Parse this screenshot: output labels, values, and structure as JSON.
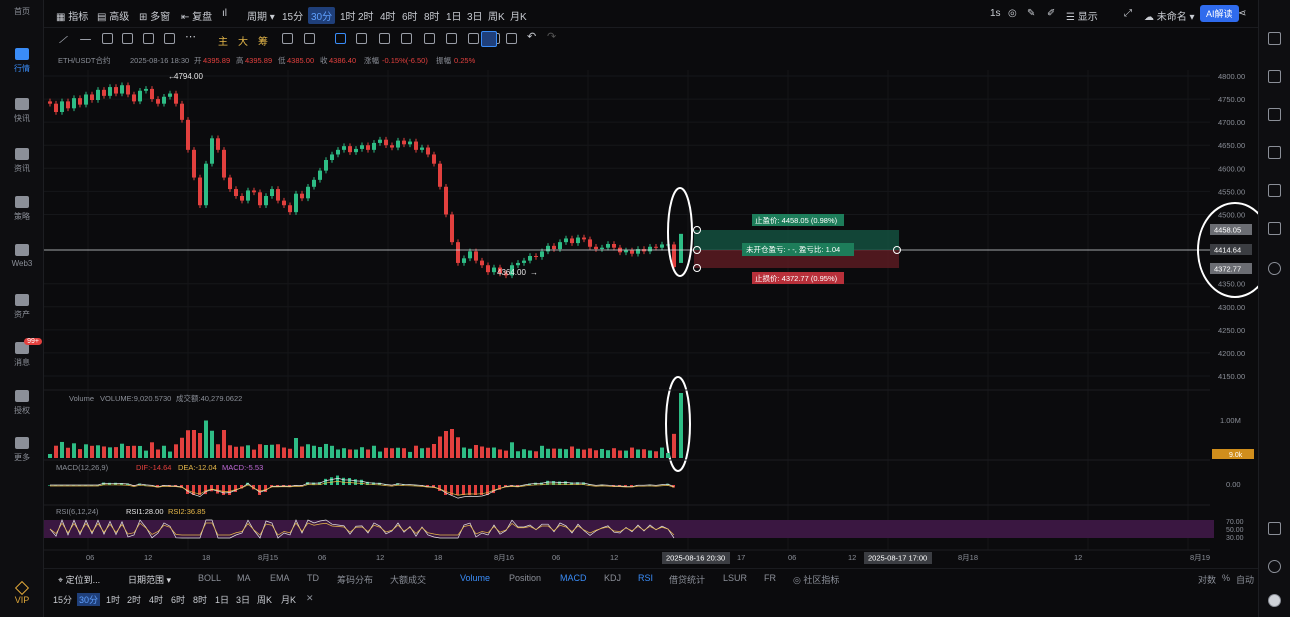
{
  "sidebar": {
    "items": [
      {
        "label": "首页"
      },
      {
        "label": "行情"
      },
      {
        "label": "快讯"
      },
      {
        "label": "资讯"
      },
      {
        "label": "策略"
      },
      {
        "label": "Web3"
      },
      {
        "label": "资产"
      },
      {
        "label": "消息"
      },
      {
        "label": "授权"
      },
      {
        "label": "更多"
      }
    ],
    "badge": "99+",
    "vip": "VIP"
  },
  "toolbar": {
    "indicators": "指标",
    "advanced": "高级",
    "multi_chart": "多窗",
    "replay": "复盘",
    "period": "周期",
    "intervals": [
      "15分",
      "30分",
      "1时",
      "2时",
      "4时",
      "6时",
      "8时",
      "1日",
      "3日",
      "周K",
      "月K"
    ],
    "interval_selected": "30分",
    "tick_interval": "1s",
    "display": "显示",
    "layout_name": "未命名",
    "ai": "AI解读"
  },
  "draw_tools": {
    "main": "主",
    "big": "大",
    "chips": "筹"
  },
  "info_line": {
    "symbol": "ETH/USDT合约",
    "time": "2025-08-16 18:30",
    "open_label": "开",
    "open": "4395.89",
    "high_label": "高",
    "high": "4395.89",
    "low_label": "低",
    "low": "4385.00",
    "close_label": "收",
    "close": "4386.40",
    "change_label": "涨幅",
    "change": "-0.15%(-6.50)",
    "amplitude_label": "振幅",
    "amplitude": "0.25%"
  },
  "chart_data": {
    "type": "candlestick",
    "symbol": "ETH/USDT",
    "interval": "30分",
    "ylim": [
      4150,
      4800
    ],
    "price_ticks": [
      "4800.00",
      "4750.00",
      "4700.00",
      "4650.00",
      "4600.00",
      "4550.00",
      "4500.00",
      "4350.00",
      "4300.00",
      "4250.00",
      "4200.00",
      "4150.00"
    ],
    "high_marker": "4794.00",
    "low_marker": "4364.00",
    "price_close": [
      4740,
      4722,
      4745,
      4730,
      4752,
      4738,
      4760,
      4748,
      4770,
      4757,
      4776,
      4762,
      4780,
      4760,
      4745,
      4768,
      4772,
      4750,
      4740,
      4755,
      4762,
      4740,
      4705,
      4640,
      4580,
      4520,
      4610,
      4665,
      4640,
      4580,
      4555,
      4540,
      4530,
      4552,
      4548,
      4520,
      4540,
      4555,
      4530,
      4520,
      4505,
      4545,
      4535,
      4560,
      4575,
      4595,
      4618,
      4630,
      4640,
      4648,
      4635,
      4642,
      4650,
      4640,
      4655,
      4662,
      4650,
      4645,
      4660,
      4652,
      4658,
      4640,
      4645,
      4630,
      4610,
      4560,
      4500,
      4440,
      4395,
      4405,
      4420,
      4400,
      4390,
      4375,
      4385,
      4372,
      4368,
      4390,
      4395,
      4400,
      4410,
      4408,
      4420,
      4432,
      4425,
      4440,
      4448,
      4438,
      4450,
      4446,
      4430,
      4425,
      4428,
      4436,
      4428,
      4418,
      4422,
      4415,
      4425,
      4420,
      4430,
      4428,
      4435,
      4435,
      4386
    ],
    "last_candle": {
      "open": 4395,
      "close": 4458
    },
    "stop_profit": {
      "label": "止盈价: 4458.05 (0.98%)",
      "price": 4458.05
    },
    "stop_loss": {
      "label": "止损价: 4372.77 (0.95%)",
      "price": 4372.77
    },
    "position": {
      "label": "未开仓盈亏: - -, 盈亏比: 1.04",
      "price": 4414.64
    },
    "right_price_tags": [
      "4458.05",
      "4414.64",
      "4372.77"
    ],
    "volume_label": "Volume",
    "volume_text": "VOLUME:9,020.5730",
    "volume_amount": "成交额:40,279.0622",
    "volume_ticks": [
      "1.00M"
    ],
    "volume_tag": "9.0k",
    "macd_label": "MACD(12,26,9)",
    "macd_dif": "DIF:-14.64",
    "macd_dea": "DEA:-12.04",
    "macd_value": "MACD:-5.53",
    "macd_tick": "0.00",
    "rsi_label": "RSI(6,12,24)",
    "rsi1": "RSI1:28.00",
    "rsi2": "RSI2:36.85",
    "rsi_ticks": [
      "70.00",
      "50.00",
      "30.00"
    ],
    "x_ticks": [
      "06",
      "12",
      "18",
      "8月15",
      "06",
      "12",
      "18",
      "8月16",
      "06",
      "12",
      "17",
      "06",
      "12",
      "8月18",
      "12",
      "8月19"
    ],
    "x_cursor": "2025-08-16 20:30",
    "x_cursor2": "2025-08-17 17:00"
  },
  "bottom": {
    "locate": "定位到...",
    "date_range": "日期范围",
    "indicators": [
      "BOLL",
      "MA",
      "EMA",
      "TD",
      "筹码分布",
      "大额成交",
      "Volume",
      "Position",
      "MACD",
      "KDJ",
      "RSI",
      "借贷统计",
      "LSUR",
      "FR",
      "社区指标"
    ],
    "active": [
      "Volume",
      "MACD",
      "RSI"
    ],
    "log_label": "对数",
    "pct_label": "%",
    "auto_label": "自动",
    "intervals": [
      "15分",
      "30分",
      "1时",
      "2时",
      "4时",
      "6时",
      "8时",
      "1日",
      "3日",
      "周K",
      "月K"
    ],
    "interval_selected": "30分"
  },
  "colors": {
    "up": "#2ebd85",
    "down": "#e2403e",
    "accent": "#3a8cf7",
    "annotation": "#ffffff"
  }
}
